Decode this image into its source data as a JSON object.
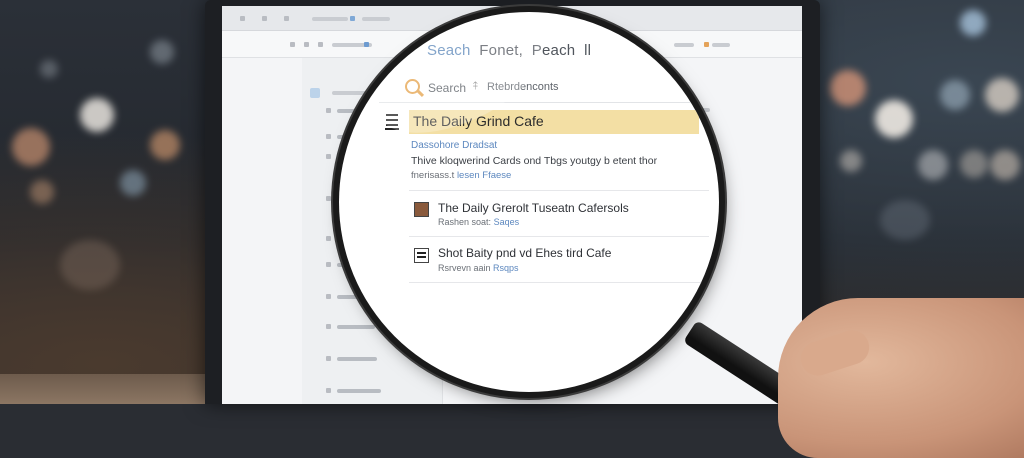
{
  "lens": {
    "title_parts": [
      "Seach",
      "Fonet,",
      "Peach",
      "ll"
    ],
    "search": {
      "label": "Search",
      "sub_label": "Rtebrdenconts"
    },
    "highlighted_result": "The Daily Grind Cafe",
    "detail": {
      "link": "Dassohore Dradsat",
      "description": "Thive kloqwerind Cards ond Tbgs youtgy b etent thor",
      "meta_prefix": "fnerisass.t",
      "meta_link": "lesen",
      "meta_suffix": "Ffaese"
    },
    "results": [
      {
        "title": "The Daily Grerolt Tuseatn Cafersols",
        "sub_prefix": "Rashen soat:",
        "sub_link": "Saqes"
      },
      {
        "title": "Shot Baity pnd vd Ehes tird Cafe",
        "sub_prefix": "Rsrvevn aain",
        "sub_link": "Rsqps"
      }
    ]
  },
  "colors": {
    "highlight": "#f3dfa4",
    "link": "#5d88bf",
    "search_icon": "#e5a24a"
  }
}
